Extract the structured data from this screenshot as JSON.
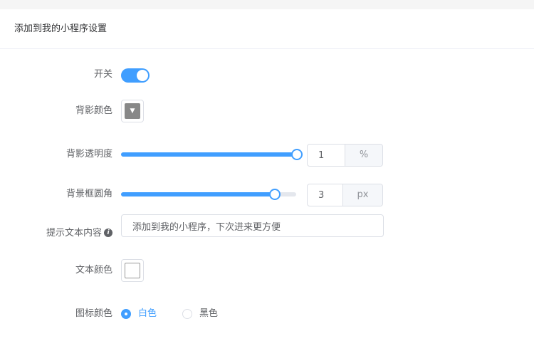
{
  "panel": {
    "title": "添加到我的小程序设置"
  },
  "form": {
    "switch": {
      "label": "开关",
      "on": true
    },
    "bg_color": {
      "label": "背影颜色",
      "value": "#888888",
      "arrow_icon": "chevron-down-icon"
    },
    "bg_opacity": {
      "label": "背影透明度",
      "value": "1",
      "unit": "%",
      "slider_fraction": 1.0
    },
    "border_radius": {
      "label": "背景框圆角",
      "value": "3",
      "unit": "px",
      "slider_fraction": 0.88
    },
    "tip_text": {
      "label": "提示文本内容",
      "info_icon": "info-icon",
      "value": "添加到我的小程序，下次进来更方便"
    },
    "text_color": {
      "label": "文本颜色",
      "value": "#ffffff"
    },
    "icon_color": {
      "label": "图标颜色",
      "options": [
        {
          "label": "白色",
          "checked": true
        },
        {
          "label": "黑色",
          "checked": false
        }
      ]
    }
  },
  "colors": {
    "accent": "#409eff",
    "border": "#dcdfe6"
  }
}
